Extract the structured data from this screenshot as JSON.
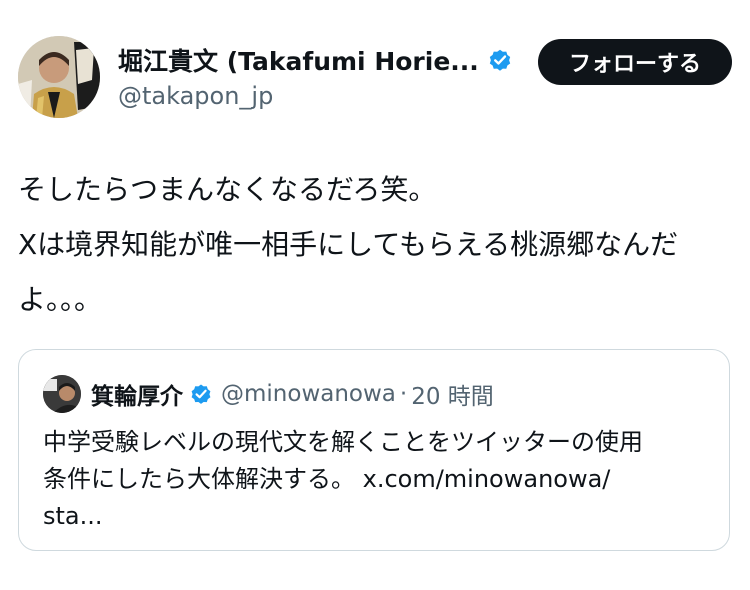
{
  "author": {
    "display_name": "堀江貴文 (Takafumi Horie...",
    "handle": "@takapon_jp",
    "verified": true,
    "avatar_icon": "profile-photo-avatar"
  },
  "follow_button": {
    "label": "フォローする"
  },
  "tweet": {
    "lines": [
      "そしたらつまんなくなるだろ笑。",
      "Xは境界知能が唯一相手にしてもらえる桃源郷なんだ",
      "よ。。。"
    ]
  },
  "quoted_tweet": {
    "display_name": "箕輪厚介",
    "handle": "@minowanowa",
    "separator": "·",
    "time": "20 時間",
    "verified": true,
    "lines": [
      "中学受験レベルの現代文を解くことをツイッターの使用",
      "条件にしたら大体解決する。 x.com/minowanowa/",
      "sta..."
    ]
  },
  "colors": {
    "text_primary": "#0f1419",
    "text_secondary": "#536471",
    "verified_blue": "#1d9bf0",
    "button_bg": "#0f1419",
    "card_border": "#cfd9de"
  }
}
